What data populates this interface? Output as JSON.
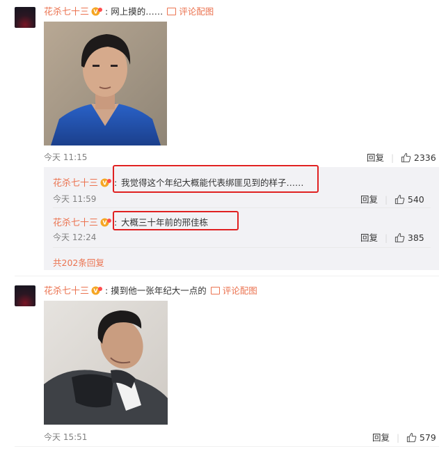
{
  "comments": [
    {
      "user": "花杀七十三",
      "text": "网上摸的……",
      "pic_label": "评论配图",
      "time": "今天 11:15",
      "reply_label": "回复",
      "likes": "2336",
      "replies": [
        {
          "user": "花杀七十三",
          "text": "我觉得这个年纪大概能代表绑匪见到的样子……",
          "time": "今天 11:59",
          "reply_label": "回复",
          "likes": "540"
        },
        {
          "user": "花杀七十三",
          "text": "大概三十年前的邢佳栋",
          "time": "今天 12:24",
          "reply_label": "回复",
          "likes": "385"
        }
      ],
      "more_replies": "共202条回复"
    },
    {
      "user": "花杀七十三",
      "text": "摸到他一张年纪大一点的",
      "pic_label": "评论配图",
      "time": "今天 15:51",
      "reply_label": "回复",
      "likes": "579"
    }
  ],
  "colors": {
    "username": "#eb7350",
    "highlight": "#e02020",
    "reply_bg": "#f2f2f5"
  },
  "icons": [
    "avatar",
    "vip-badge-icon",
    "picture-icon",
    "thumbs-up-icon"
  ]
}
